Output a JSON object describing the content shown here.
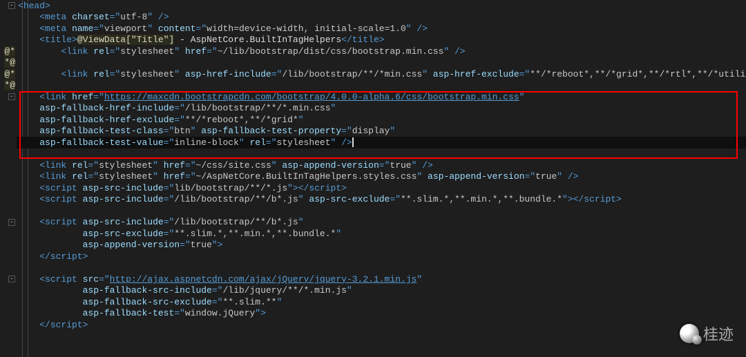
{
  "gutter": {
    "razor_marker": "@*",
    "razor_end": "*@"
  },
  "lines": {
    "head": {
      "open": "<",
      "tag": "head",
      "close": ">"
    },
    "meta1": {
      "pad": "    ",
      "open": "<",
      "tag": "meta",
      "sp": " ",
      "a1": "charset",
      "eq": "=\"",
      "v1": "utf-8",
      "end": "\" />"
    },
    "meta2": {
      "pad": "    ",
      "open": "<",
      "tag": "meta",
      "sp": " ",
      "a1": "name",
      "eq": "=\"",
      "v1": "viewport",
      "q": "\" ",
      "a2": "content",
      "eq2": "=\"",
      "v2": "width=device-width, initial-scale=1.0",
      "end": "\" />"
    },
    "title": {
      "pad": "    ",
      "open": "<",
      "tag": "title",
      "close": ">",
      "razor": "@ViewData[\"Title\"]",
      "txt": " - AspNetCore.BuiltInTagHelpers",
      "openE": "</",
      "tagE": "title",
      "closeE": ">"
    },
    "l5": {
      "pad": "        ",
      "open": "<",
      "tag": "link",
      "sp": " ",
      "a1": "rel",
      "eq": "=\"",
      "v1": "stylesheet",
      "q": "\" ",
      "a2": "href",
      "eq2": "=\"",
      "v2": "~/lib/bootstrap/dist/css/bootstrap.min.css",
      "end": "\" />"
    },
    "l7": {
      "pad": "        ",
      "open": "<",
      "tag": "link",
      "sp": " ",
      "a1": "rel",
      "eq": "=\"",
      "v1": "stylesheet",
      "q": "\" ",
      "a2": "asp-href-include",
      "eq2": "=\"",
      "v2": "/lib/bootstrap/**/*min.css",
      "q2": "\" ",
      "a3": "asp-href-exclude",
      "eq3": "=\"",
      "v3": "**/*reboot*,**/*grid*,**/*rtl*,**/*utilities*"
    },
    "box1": {
      "pad": "    ",
      "open": "<",
      "tag": "link",
      "sp": " ",
      "a1": "href",
      "eq": "=\"",
      "url": "https://maxcdn.bootstrapcdn.com/bootstrap/4.0.0-alpha.6/css/bootstrap.min.css",
      "q": "\""
    },
    "box2": {
      "pad": "    ",
      "a1": "asp-fallback-href-include",
      "eq": "=\"",
      "v1": "/lib/bootstrap/**/*.min.css",
      "q": "\""
    },
    "box3": {
      "pad": "    ",
      "a1": "asp-fallback-href-exclude",
      "eq": "=\"",
      "v1": "**/*reboot*,**/*grid*",
      "q": "\""
    },
    "box4": {
      "pad": "    ",
      "a1": "asp-fallback-test-class",
      "eq": "=\"",
      "v1": "btn",
      "q": "\" ",
      "a2": "asp-fallback-test-property",
      "eq2": "=\"",
      "v2": "display",
      "q2": "\""
    },
    "box5": {
      "pad": "    ",
      "a1": "asp-fallback-test-value",
      "eq": "=\"",
      "v1": "inline-block",
      "q": "\" ",
      "a2": "rel",
      "eq2": "=\"",
      "v2": "stylesheet",
      "end": "\" />"
    },
    "l14": {
      "pad": "    ",
      "open": "<",
      "tag": "link",
      "sp": " ",
      "a1": "rel",
      "eq": "=\"",
      "v1": "stylesheet",
      "q": "\" ",
      "a2": "href",
      "eq2": "=\"",
      "v2": "~/css/site.css",
      "q2": "\" ",
      "a3": "asp-append-version",
      "eq3": "=\"",
      "v3": "true",
      "end": "\" />"
    },
    "l15": {
      "pad": "    ",
      "open": "<",
      "tag": "link",
      "sp": " ",
      "a1": "rel",
      "eq": "=\"",
      "v1": "stylesheet",
      "q": "\" ",
      "a2": "href",
      "eq2": "=\"",
      "v2": "~/AspNetCore.BuiltInTagHelpers.styles.css",
      "q2": "\" ",
      "a3": "asp-append-version",
      "eq3": "=\"",
      "v3": "true",
      "end": "\" />"
    },
    "l16": {
      "pad": "    ",
      "open": "<",
      "tag": "script",
      "sp": " ",
      "a1": "asp-src-include",
      "eq": "=\"",
      "v1": "lib/bootstrap/**/*.js",
      "q": "\">",
      "openE": "</",
      "tagE": "script",
      "closeE": ">"
    },
    "l17": {
      "pad": "    ",
      "open": "<",
      "tag": "script",
      "sp": " ",
      "a1": "asp-src-include",
      "eq": "=\"",
      "v1": "/lib/bootstrap/**/b*.js",
      "q": "\" ",
      "a2": "asp-src-exclude",
      "eq2": "=\"",
      "v2": "**.slim.*,**.min.*,**.bundle.*",
      "q2": "\">",
      "openE": "</",
      "tagE": "script",
      "closeE": ">"
    },
    "l19": {
      "pad": "    ",
      "open": "<",
      "tag": "script",
      "sp": " ",
      "a1": "asp-src-include",
      "eq": "=\"",
      "v1": "/lib/bootstrap/**/b*.js",
      "q": "\""
    },
    "l20": {
      "pad": "            ",
      "a1": "asp-src-exclude",
      "eq": "=\"",
      "v1": "**.slim.*,**.min.*,**.bundle.*",
      "q": "\""
    },
    "l21": {
      "pad": "            ",
      "a1": "asp-append-version",
      "eq": "=\"",
      "v1": "true",
      "q": "\">"
    },
    "l22": {
      "pad": "    ",
      "open": "</",
      "tag": "script",
      "close": ">"
    },
    "l24a": {
      "pad": "    ",
      "open": "<",
      "tag": "script",
      "sp": " ",
      "a1": "src",
      "eq": "=\"",
      "url": "http://ajax.aspnetcdn.com/ajax/jQuery/jquery-3.2.1.min.js",
      "q": "\""
    },
    "l24": {
      "pad": "            ",
      "a1": "asp-fallback-src-include",
      "eq": "=\"",
      "v1": "/lib/jquery/**/*.min.js",
      "q": "\""
    },
    "l25": {
      "pad": "            ",
      "a1": "asp-fallback-src-exclude",
      "eq": "=\"",
      "v1": "**.slim.**",
      "q": "\""
    },
    "l26": {
      "pad": "            ",
      "a1": "asp-fallback-test",
      "eq": "=\"",
      "v1": "window.jQuery",
      "q": "\">"
    },
    "l27": {
      "pad": "    ",
      "open": "</",
      "tag": "script",
      "close": ">"
    }
  },
  "watermark": "桂迹"
}
